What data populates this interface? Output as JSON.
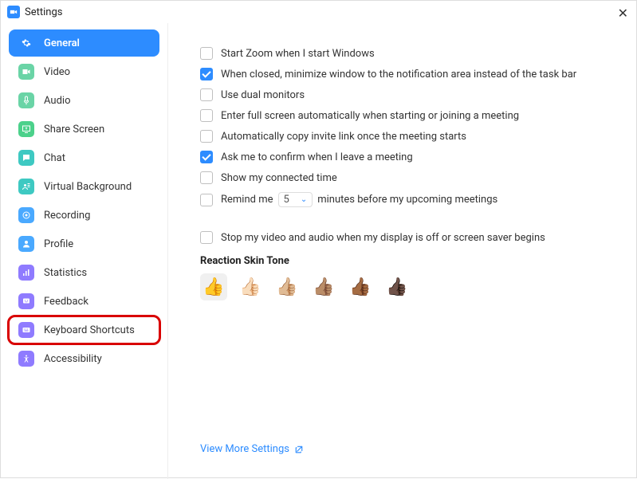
{
  "window": {
    "title": "Settings"
  },
  "sidebar": {
    "items": [
      {
        "id": "general",
        "label": "General",
        "color": "#ffffff",
        "bg": "#2d8cff",
        "active": true
      },
      {
        "id": "video",
        "label": "Video",
        "bg": "#6ad4a6"
      },
      {
        "id": "audio",
        "label": "Audio",
        "bg": "#6ad4a6"
      },
      {
        "id": "share-screen",
        "label": "Share Screen",
        "bg": "#4cd18b"
      },
      {
        "id": "chat",
        "label": "Chat",
        "bg": "#3ec9c2"
      },
      {
        "id": "virtual-background",
        "label": "Virtual Background",
        "bg": "#3ec9c2"
      },
      {
        "id": "recording",
        "label": "Recording",
        "bg": "#4aa9ff"
      },
      {
        "id": "profile",
        "label": "Profile",
        "bg": "#4aa9ff"
      },
      {
        "id": "statistics",
        "label": "Statistics",
        "bg": "#8f7bff"
      },
      {
        "id": "feedback",
        "label": "Feedback",
        "bg": "#8f7bff"
      },
      {
        "id": "keyboard-shortcuts",
        "label": "Keyboard Shortcuts",
        "bg": "#8f7bff",
        "highlight": true
      },
      {
        "id": "accessibility",
        "label": "Accessibility",
        "bg": "#8f7bff"
      }
    ]
  },
  "settings": {
    "rows": [
      {
        "label": "Start Zoom when I start Windows",
        "checked": false
      },
      {
        "label": "When closed, minimize window to the notification area instead of the task bar",
        "checked": true
      },
      {
        "label": "Use dual monitors",
        "checked": false
      },
      {
        "label": "Enter full screen automatically when starting or joining a meeting",
        "checked": false
      },
      {
        "label": "Automatically copy invite link once the meeting starts",
        "checked": false
      },
      {
        "label": "Ask me to confirm when I leave a meeting",
        "checked": true
      },
      {
        "label": "Show my connected time",
        "checked": false
      }
    ],
    "remind": {
      "prefix": "Remind me",
      "value": "5",
      "suffix": "minutes before my upcoming meetings",
      "checked": false
    },
    "spacer_row": {
      "label": "Stop my video and audio when my display is off or screen saver begins",
      "checked": false
    },
    "reaction_heading": "Reaction Skin Tone",
    "tones": [
      "👍",
      "👍🏻",
      "👍🏼",
      "👍🏽",
      "👍🏾",
      "👍🏿"
    ],
    "tone_selected_index": 0,
    "view_more": "View More Settings"
  }
}
